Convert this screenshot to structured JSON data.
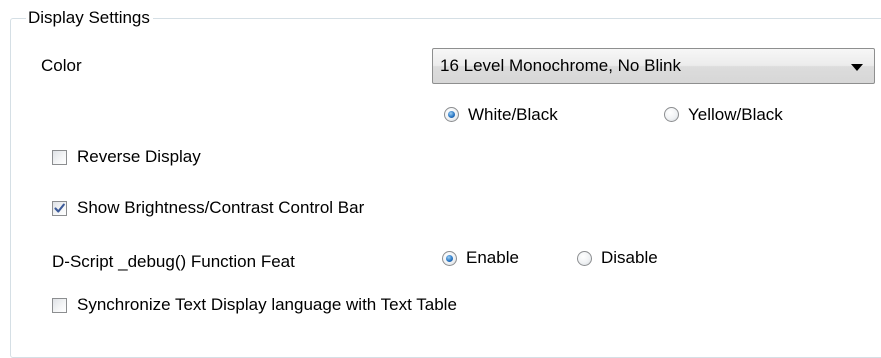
{
  "group": {
    "title": "Display Settings"
  },
  "color": {
    "label": "Color",
    "selected": "16 Level Monochrome, No Blink",
    "options": [
      {
        "label": "White/Black",
        "checked": true
      },
      {
        "label": "Yellow/Black",
        "checked": false
      }
    ]
  },
  "reverse_display": {
    "label": "Reverse Display",
    "checked": false
  },
  "brightness_bar": {
    "label": "Show Brightness/Contrast Control Bar",
    "checked": true
  },
  "debug": {
    "label": "D-Script _debug() Function Feat",
    "options": [
      {
        "label": "Enable",
        "checked": true
      },
      {
        "label": "Disable",
        "checked": false
      }
    ]
  },
  "sync_language": {
    "label": "Synchronize Text Display language with Text Table",
    "checked": false
  },
  "colors": {
    "border": "#d5dfe5",
    "radio_dot": "#2a78c5",
    "checkmark": "#3c5a99"
  },
  "icons": {
    "dropdown": "chevron-down-icon",
    "check": "checkmark-icon"
  }
}
